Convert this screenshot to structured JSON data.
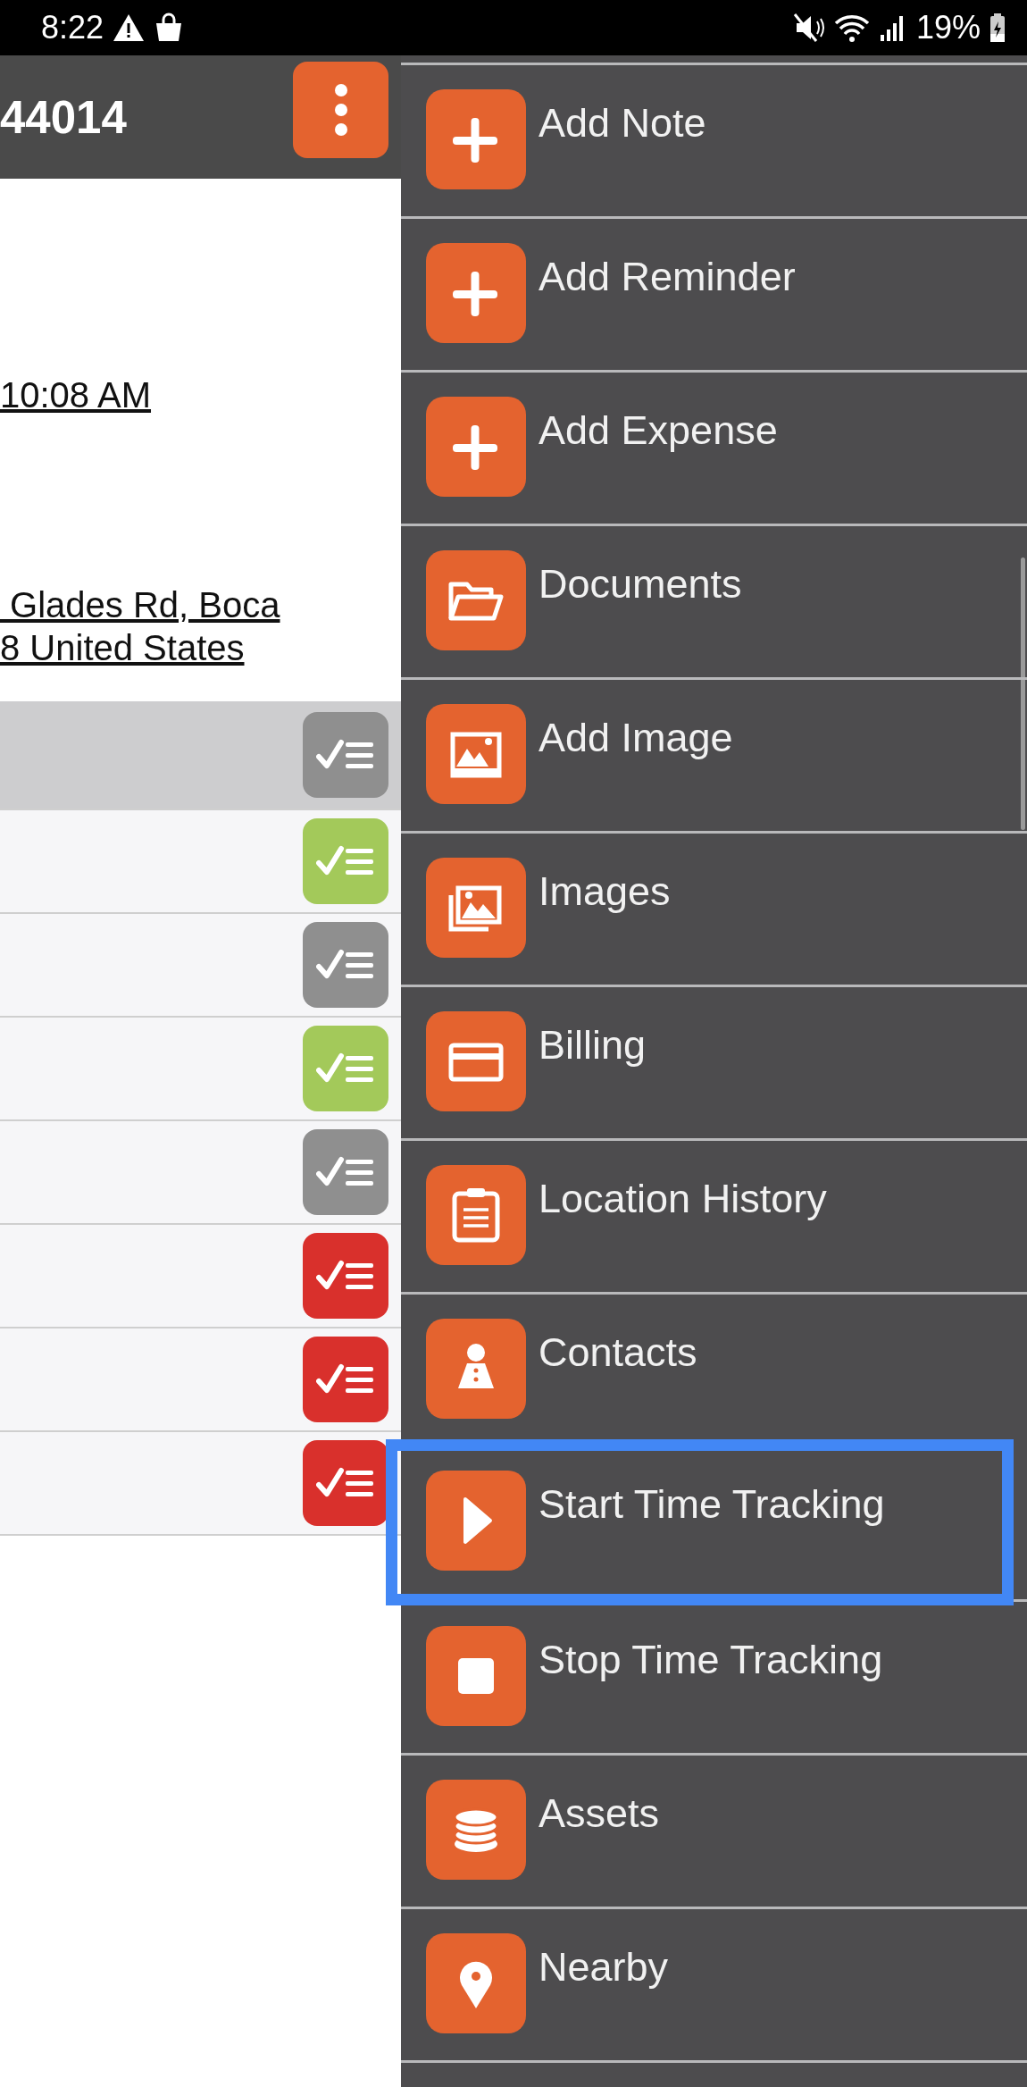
{
  "status_bar": {
    "time": "8:22",
    "battery": "19%"
  },
  "header": {
    "title": "44014"
  },
  "details": {
    "time_link": "10:08 AM",
    "address_lines": [
      " Glades Rd, Boca",
      "8 United States"
    ]
  },
  "tasks": [
    {
      "selected": true,
      "color": "#8f8f8f"
    },
    {
      "selected": false,
      "color": "#a3c95a"
    },
    {
      "selected": false,
      "color": "#8f8f8f"
    },
    {
      "selected": false,
      "color": "#a3c95a"
    },
    {
      "selected": false,
      "color": "#8f8f8f"
    },
    {
      "selected": false,
      "color": "#d9302c"
    },
    {
      "selected": false,
      "color": "#d9302c"
    },
    {
      "selected": false,
      "color": "#d9302c"
    }
  ],
  "menu": [
    {
      "label": "Add Note",
      "selected": false
    },
    {
      "label": "Add Reminder",
      "selected": false
    },
    {
      "label": "Add Expense",
      "selected": false
    },
    {
      "label": "Documents",
      "selected": false
    },
    {
      "label": "Add Image",
      "selected": false
    },
    {
      "label": "Images",
      "selected": false
    },
    {
      "label": "Billing",
      "selected": false
    },
    {
      "label": "Location History",
      "selected": false
    },
    {
      "label": "Contacts",
      "selected": false
    },
    {
      "label": "Start Time Tracking",
      "selected": true
    },
    {
      "label": "Stop Time Tracking",
      "selected": false
    },
    {
      "label": "Assets",
      "selected": false
    },
    {
      "label": "Nearby",
      "selected": false
    }
  ]
}
